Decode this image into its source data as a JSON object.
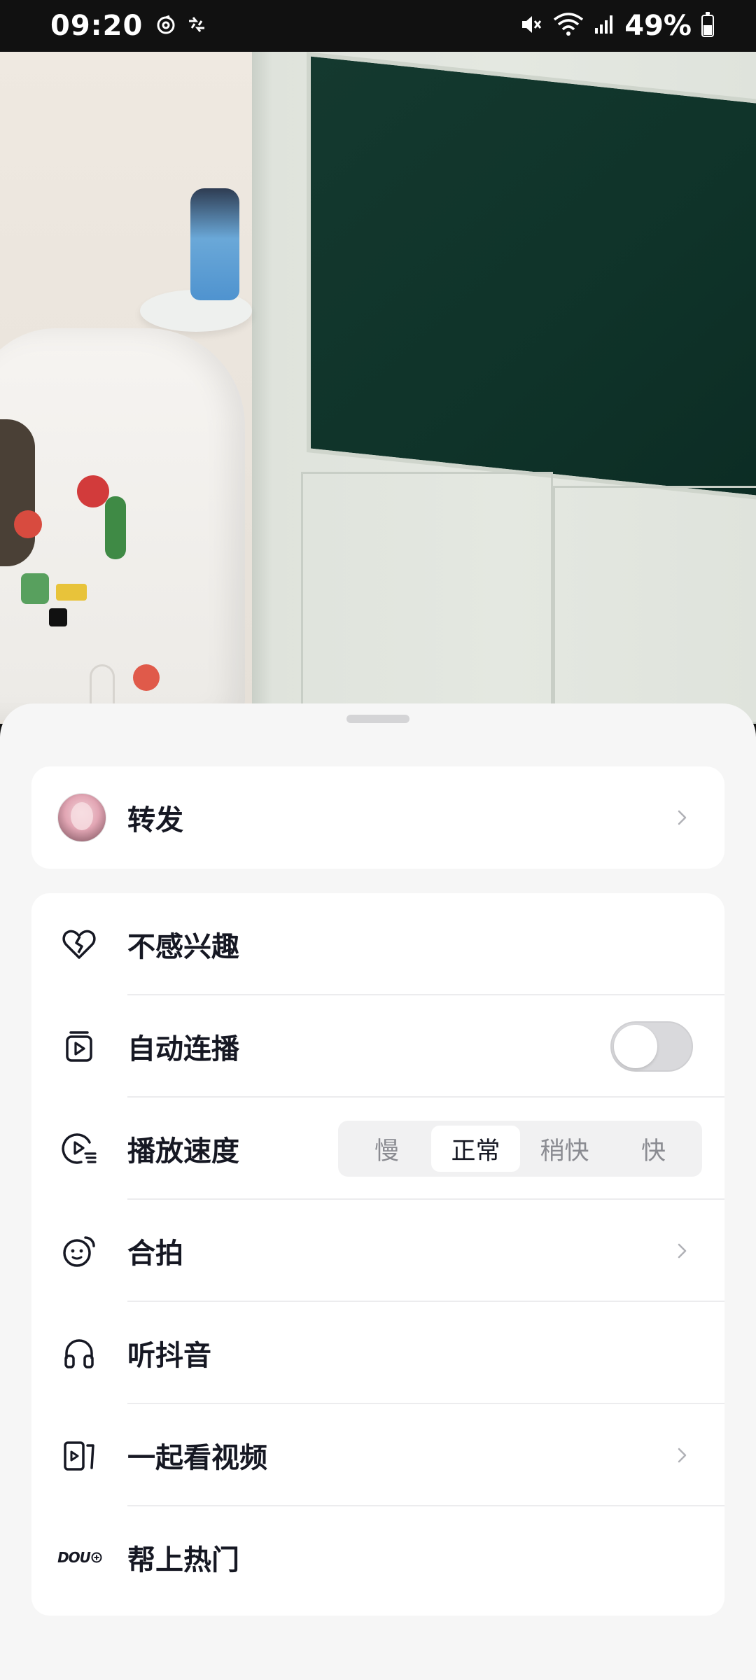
{
  "status_bar": {
    "time": "09:20",
    "battery": "49%",
    "battery_level": 0.49,
    "icons": [
      "netease-music-icon",
      "vpn-sync-icon",
      "mute-icon",
      "wifi-icon",
      "signal-icon",
      "battery-icon"
    ]
  },
  "sheet": {
    "forward": {
      "label": "转发",
      "icon": "avatar"
    },
    "items": [
      {
        "label": "不感兴趣",
        "icon": "broken-heart-icon"
      },
      {
        "label": "自动连播",
        "icon": "autoplay-icon",
        "toggle_on": false
      },
      {
        "label": "播放速度",
        "icon": "playback-speed-icon",
        "options": [
          "慢",
          "正常",
          "稍快",
          "快"
        ],
        "selected": "正常"
      },
      {
        "label": "合拍",
        "icon": "duet-icon"
      },
      {
        "label": "听抖音",
        "icon": "headphones-icon"
      },
      {
        "label": "一起看视频",
        "icon": "watch-together-icon"
      },
      {
        "label": "帮上热门",
        "icon": "dou-plus-icon",
        "icon_text": "DOU"
      }
    ]
  },
  "colors": {
    "sheet_bg": "#f6f6f6",
    "card_bg": "#ffffff",
    "text": "#161823",
    "toggle_off": "#d9d9dc"
  }
}
